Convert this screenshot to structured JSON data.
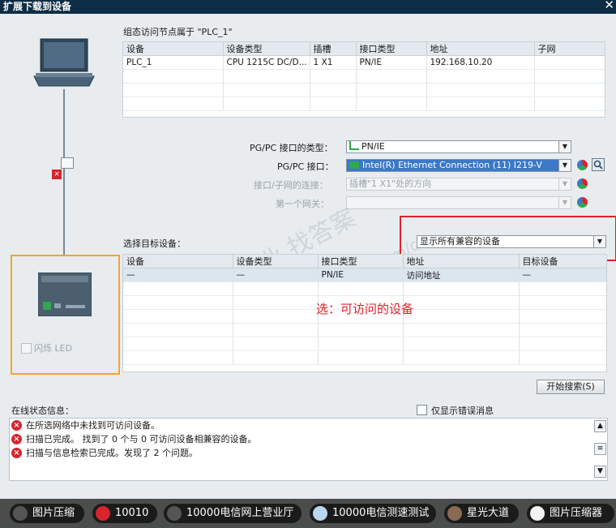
{
  "window": {
    "title": "扩展下载到设备",
    "close_glyph": "✕"
  },
  "access_nodes": {
    "caption": "组态访问节点属于 \"PLC_1\"",
    "columns": [
      "设备",
      "设备类型",
      "插槽",
      "接口类型",
      "地址",
      "子网"
    ],
    "rows": [
      [
        "PLC_1",
        "CPU 1215C DC/D...",
        "1 X1",
        "PN/IE",
        "192.168.10.20",
        ""
      ]
    ]
  },
  "interface": {
    "pgpc_type_label": "PG/PC 接口的类型：",
    "pgpc_type_value": "PN/IE",
    "pgpc_iface_label": "PG/PC 接口：",
    "pgpc_iface_value": "Intel(R) Ethernet Connection (11) I219-V",
    "subnet_conn_label": "接口/子网的连接：",
    "subnet_conn_value": "插槽\"1 X1\"处的方向",
    "gateway_label": "第一个网关："
  },
  "target": {
    "label": "选择目标设备：",
    "filter_value": "显示所有兼容的设备",
    "columns": [
      "设备",
      "设备类型",
      "接口类型",
      "地址",
      "目标设备"
    ],
    "rows": [
      [
        "—",
        "—",
        "PN/IE",
        "访问地址",
        "—"
      ]
    ],
    "annotation": "选：可访问的设备"
  },
  "left_panel": {
    "flash_led_label": "闪烁 LED"
  },
  "search_button": "开始搜索(S)",
  "status": {
    "label": "在线状态信息：",
    "only_errors_label": "仅显示错误消息",
    "messages": [
      "在所选网络中未找到可访问设备。",
      "扫描已完成。 找到了 0 个与 0 可访问设备相兼容的设备。",
      "扫描与信息检索已完成。发现了 2 个问题。"
    ]
  },
  "taskbar": {
    "items": [
      "图片压缩",
      "10010",
      "10000电信网上营业厅",
      "10000电信测速测试",
      "星光大道",
      "图片压缩器"
    ]
  },
  "watermark": {
    "line1": "西门子工业  找答案",
    "line2": "support.industry.siemens.com/cs"
  },
  "colors": {
    "title_bg": "#0c2d45",
    "accent_blue": "#3b78c8",
    "highlight_red": "#e2202a",
    "highlight_orange": "#f4a42a",
    "error_red": "#d9232d"
  }
}
